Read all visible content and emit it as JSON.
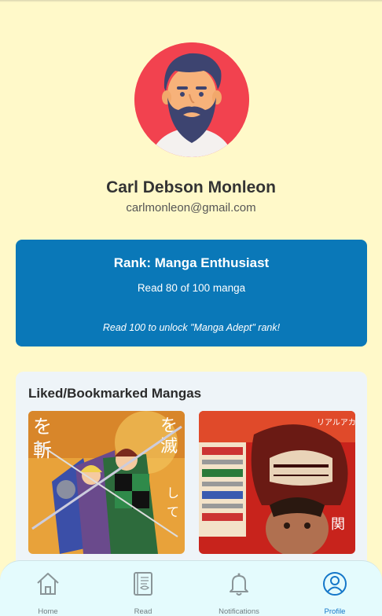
{
  "profile": {
    "name": "Carl Debson Monleon",
    "email": "carlmonleon@gmail.com"
  },
  "rank": {
    "title": "Rank: Manga Enthusiast",
    "progress_text": "Read 80 of 100 manga",
    "read_count": 80,
    "goal_count": 100,
    "hint": "Read 100 to unlock \"Manga Adept\" rank!"
  },
  "liked": {
    "title": "Liked/Bookmarked Mangas",
    "covers": [
      {
        "icon": "manga-cover-demon-slayer"
      },
      {
        "icon": "manga-cover-attack-on-titan"
      }
    ]
  },
  "nav": {
    "items": [
      {
        "label": "Home",
        "icon": "home-icon",
        "active": false
      },
      {
        "label": "Read",
        "icon": "book-icon",
        "active": false
      },
      {
        "label": "Notifications",
        "icon": "bell-icon",
        "active": false
      },
      {
        "label": "Profile",
        "icon": "profile-icon",
        "active": true
      }
    ]
  },
  "colors": {
    "background": "#fff9c9",
    "rank_card": "#0a78b8",
    "liked_card": "#eef4f8",
    "nav_background": "#e4fbfd",
    "nav_active": "#1577c9",
    "avatar_background": "#f2424f"
  }
}
